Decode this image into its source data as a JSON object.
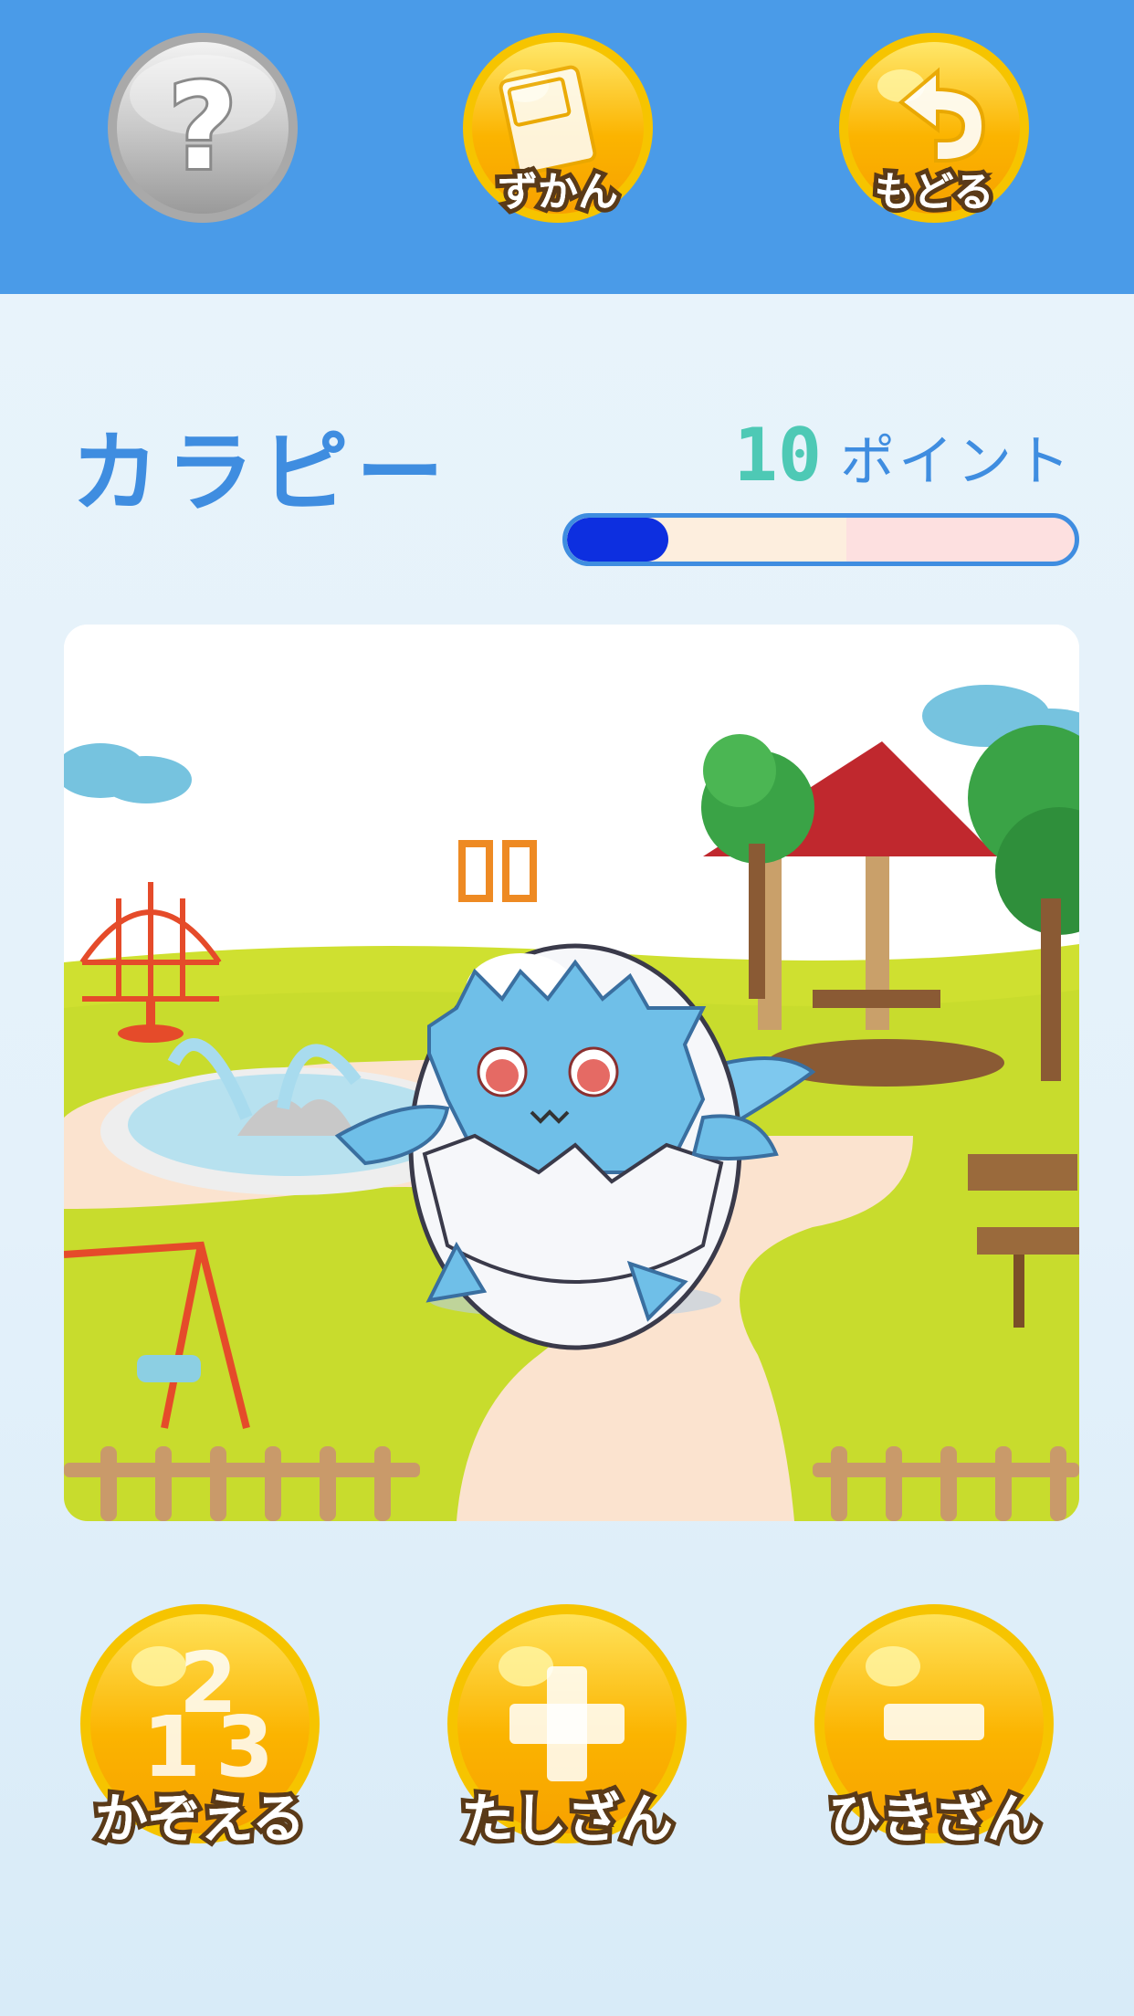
{
  "header": {
    "help_icon": "question-mark-icon",
    "zukan_label": "ずかん",
    "zukan_icon": "book-icon",
    "back_label": "もどる",
    "back_icon": "return-arrow-icon",
    "background_color": "#4a9be8"
  },
  "character": {
    "name": "カラピー",
    "points_value": "10",
    "points_unit": "ポイント",
    "progress_fraction": 0.2
  },
  "actions": {
    "count_label": "かぞえる",
    "count_icon": "numbers-123-icon",
    "add_label": "たしざん",
    "add_icon": "plus-icon",
    "subtract_label": "ひきざん",
    "subtract_icon": "minus-icon"
  },
  "colors": {
    "accent_blue": "#3f8de0",
    "points_teal": "#4ec9b5",
    "button_gold": "#f7b500",
    "button_gray": "#b8b8b8"
  }
}
